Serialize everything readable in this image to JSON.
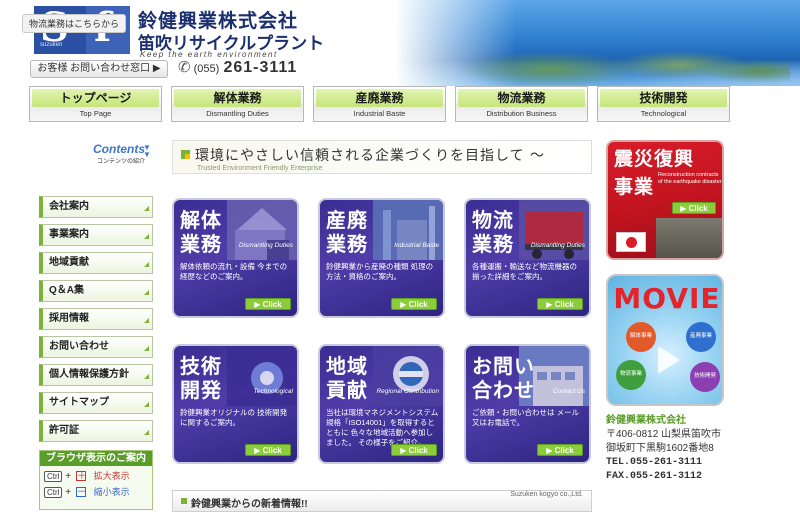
{
  "header": {
    "company_name": "鈴健興業株式会社",
    "company_sub": "笛吹リサイクルプラント",
    "tagline": "Keep the earth environment",
    "logo_letters": [
      "S",
      "f"
    ],
    "logo_small": "suzuken",
    "logistics_link": "物流業務はこちらから",
    "contact_button": "お客様 お問い合わせ窓口 ▶",
    "phone_area": "(055)",
    "phone_number": "261-3111"
  },
  "nav": [
    {
      "jp": "トップページ",
      "en": "Top Page"
    },
    {
      "jp": "解体業務",
      "en": "Dismantling Duties"
    },
    {
      "jp": "産廃業務",
      "en": "Industrial Baste"
    },
    {
      "jp": "物流業務",
      "en": "Distribution Business"
    },
    {
      "jp": "技術開発",
      "en": "Technological"
    }
  ],
  "sidebar": {
    "contents_title": "Contents",
    "contents_sub": "コンテンツの紹介",
    "items": [
      "会社案内",
      "事業案内",
      "地域貢献",
      "Q＆A集",
      "採用情報",
      "お問い合わせ",
      "個人情報保護方針",
      "サイトマップ",
      "許可証"
    ],
    "browser_box": {
      "title": "ブラウザ表示のご案内",
      "ctrl": "Ctrl",
      "plus": "＋",
      "minus": "－",
      "zoom_in": "拡大表示",
      "zoom_out": "縮小表示"
    }
  },
  "banner": {
    "jp": "環境にやさしい信頼される企業づくりを目指して 〜",
    "en": "Trusted Environment Friendly Enterprise"
  },
  "cards": [
    {
      "t1": "解体",
      "t2": "業務",
      "en": "Dismantling Duties",
      "desc": "解体依頼の流れ・設備 今までの経歴などのご案内。",
      "btn": "▶ Click"
    },
    {
      "t1": "産廃",
      "t2": "業務",
      "en": "Industrial Baste",
      "desc": "鈴健興業から産廃の種類 処理の方法・資格のご案内。",
      "btn": "▶ Click"
    },
    {
      "t1": "物流",
      "t2": "業務",
      "en": "Dismantling Duties",
      "desc": "各種運搬・輸送など物流機器の 揃った詳細をご案内。",
      "btn": "▶ Click"
    },
    {
      "t1": "技術",
      "t2": "開発",
      "en": "Technological",
      "desc": "鈴健興業オリジナルの 技術開発に関するご案内。",
      "btn": "▶ Click"
    },
    {
      "t1": "地域",
      "t2": "貢献",
      "en": "Regional Contribution",
      "desc": "当社は環境マネジメントシステム 規格「ISO14001」を取得するとともに 色々な地域活動へ参加しました。 その様子をご紹介。",
      "btn": "▶ Click"
    },
    {
      "t1": "お問い",
      "t2": "合わせ",
      "en": "Contact Us",
      "desc": "ご依頼・お問い合わせは メール又はお電話で。",
      "btn": "▶ Click"
    }
  ],
  "news": {
    "title": "鈴健興業からの新着情報!!",
    "right": "Suzuken kogyo co.,Ltd."
  },
  "quake": {
    "t1": "震災復興",
    "t2": "事業",
    "en": "Reconstruction contracts of the earthquake disaster",
    "btn": "▶ Click"
  },
  "movie": {
    "title": "MOVIE",
    "orbs": [
      "解体事業",
      "物流事業",
      "産廃事業",
      "技術開発"
    ]
  },
  "company_info": {
    "name": "鈴健興業株式会社",
    "address1": "〒406-0812 山梨県笛吹市",
    "address2": "御坂町下黒駒1602番地8",
    "tel": "TEL.055-261-3111",
    "fax": "FAX.055-261-3112"
  },
  "colors": {
    "accent_green": "#7bb33a",
    "card_purple": "#3b2d93",
    "quake_red": "#d81c2a",
    "brand_blue": "#1b2f6e"
  }
}
